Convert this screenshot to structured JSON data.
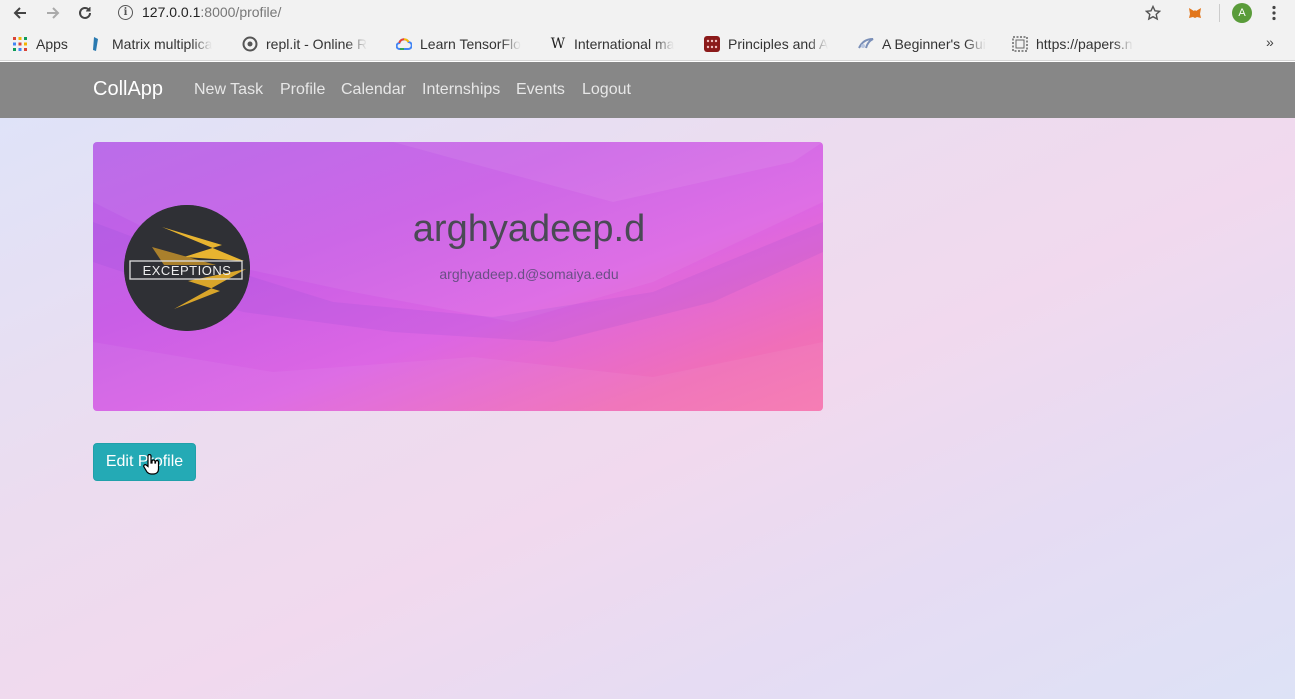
{
  "browser": {
    "url_host": "127.0.0.1",
    "url_path": ":8000/profile/",
    "profile_initial": "A",
    "bookmarks": [
      {
        "label": "Apps",
        "icon": "apps-grid-icon"
      },
      {
        "label": "Matrix multiplica",
        "icon": "matrix-bookmark-icon"
      },
      {
        "label": "repl.it - Online R",
        "icon": "replit-icon"
      },
      {
        "label": "Learn TensorFlo",
        "icon": "google-cloud-icon"
      },
      {
        "label": "International ma",
        "icon": "wikipedia-icon"
      },
      {
        "label": "Principles and A",
        "icon": "principles-bookmark-icon"
      },
      {
        "label": "A Beginner's Gui",
        "icon": "beginners-guide-icon"
      },
      {
        "label": "https://papers.n",
        "icon": "papers-page-icon"
      }
    ],
    "more_label": "»"
  },
  "navbar": {
    "brand": "CollApp",
    "links": [
      "New Task",
      "Profile",
      "Calendar",
      "Internships",
      "Events",
      "Logout"
    ]
  },
  "profile": {
    "username": "arghyadeep.d",
    "email": "arghyadeep.d@somaiya.edu",
    "logo_text": "EXCEPTIONS"
  },
  "edit_button_label": "Edit Profile",
  "colors": {
    "navbar": "#878787",
    "button": "#24aab5",
    "card_start": "#b664e8",
    "card_end": "#f677b0"
  }
}
